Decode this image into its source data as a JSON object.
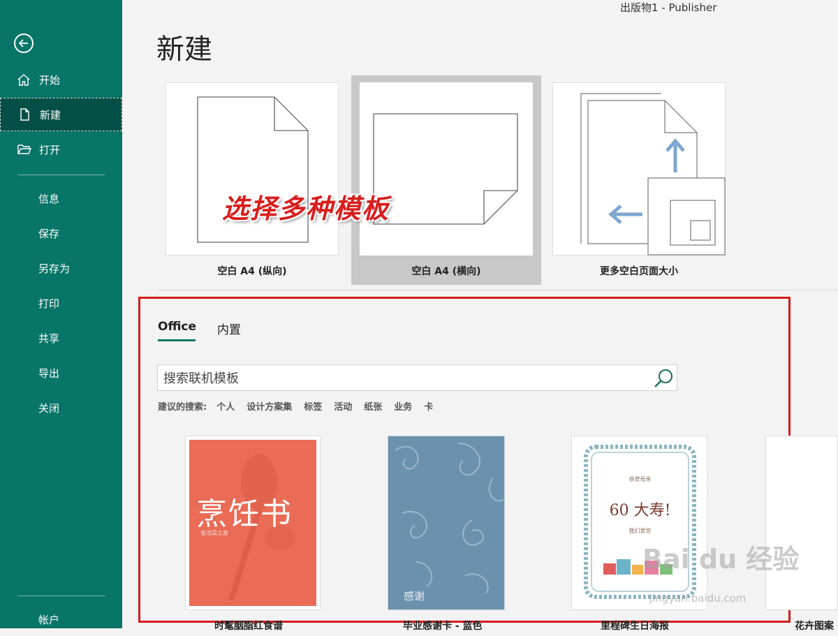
{
  "window": {
    "title": "出版物1 - Publisher"
  },
  "sidebar": {
    "items": [
      {
        "label": "开始"
      },
      {
        "label": "新建"
      },
      {
        "label": "打开"
      },
      {
        "label": "信息"
      },
      {
        "label": "保存"
      },
      {
        "label": "另存为"
      },
      {
        "label": "打印"
      },
      {
        "label": "共享"
      },
      {
        "label": "导出"
      },
      {
        "label": "关闭"
      },
      {
        "label": "帐户"
      }
    ]
  },
  "main": {
    "title": "新建",
    "blank_templates": [
      {
        "label": "空白 A4 (纵向)"
      },
      {
        "label": "空白 A4 (横向)"
      },
      {
        "label": "更多空白页面大小"
      }
    ],
    "overlay_text": "选择多种模板",
    "tabs": [
      {
        "label": "Office"
      },
      {
        "label": "内置"
      }
    ],
    "search": {
      "placeholder": "搜索联机模板"
    },
    "suggested": {
      "label": "建议的搜索:",
      "keywords": [
        "个人",
        "设计方案集",
        "标签",
        "活动",
        "纸张",
        "业务",
        "卡"
      ]
    },
    "templates": [
      {
        "caption": "时髦胭脂红食谱",
        "cover_title": "烹饪书",
        "cover_sub": "省活菜之家"
      },
      {
        "caption": "毕业感谢卡 - 蓝色",
        "cover_title": "感谢"
      },
      {
        "caption": "里程碑生日海报",
        "cover_title": "60 大寿!",
        "cover_top": "恭贺母亲",
        "cover_bottom": "我们爱您"
      },
      {
        "caption": "花卉图案"
      }
    ]
  },
  "watermark": {
    "text": "Bai du 经验",
    "url": "jingyan.baidu.com"
  },
  "colors": {
    "sidebar": "#077568",
    "sidebar_active": "#055046",
    "highlight_box": "#d41b1b"
  }
}
